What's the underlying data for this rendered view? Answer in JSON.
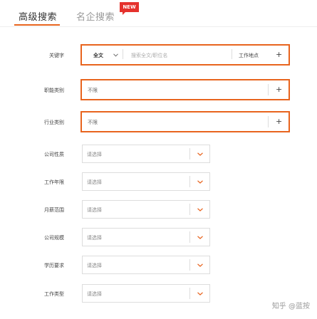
{
  "tabs": {
    "advanced_label": "高级搜索",
    "company_label": "名企搜索",
    "new_badge": "NEW"
  },
  "keyword_row": {
    "label": "关键字",
    "scope_label": "全文",
    "placeholder": "搜索全文/职位名",
    "location_label": "工作地点",
    "plus": "+"
  },
  "job_category": {
    "label": "职能类别",
    "value": "不限",
    "plus": "+"
  },
  "industry_category": {
    "label": "行业类别",
    "value": "不限",
    "plus": "+"
  },
  "selects": [
    {
      "label": "公司性质",
      "value": "请选择"
    },
    {
      "label": "工作年限",
      "value": "请选择"
    },
    {
      "label": "月薪范围",
      "value": "请选择"
    },
    {
      "label": "公司规模",
      "value": "请选择"
    },
    {
      "label": "学历要求",
      "value": "请选择"
    },
    {
      "label": "工作类型",
      "value": "请选择"
    }
  ],
  "watermark": "知乎 @蓝按",
  "colors": {
    "accent": "#e8641e",
    "badge": "#e5322d"
  }
}
